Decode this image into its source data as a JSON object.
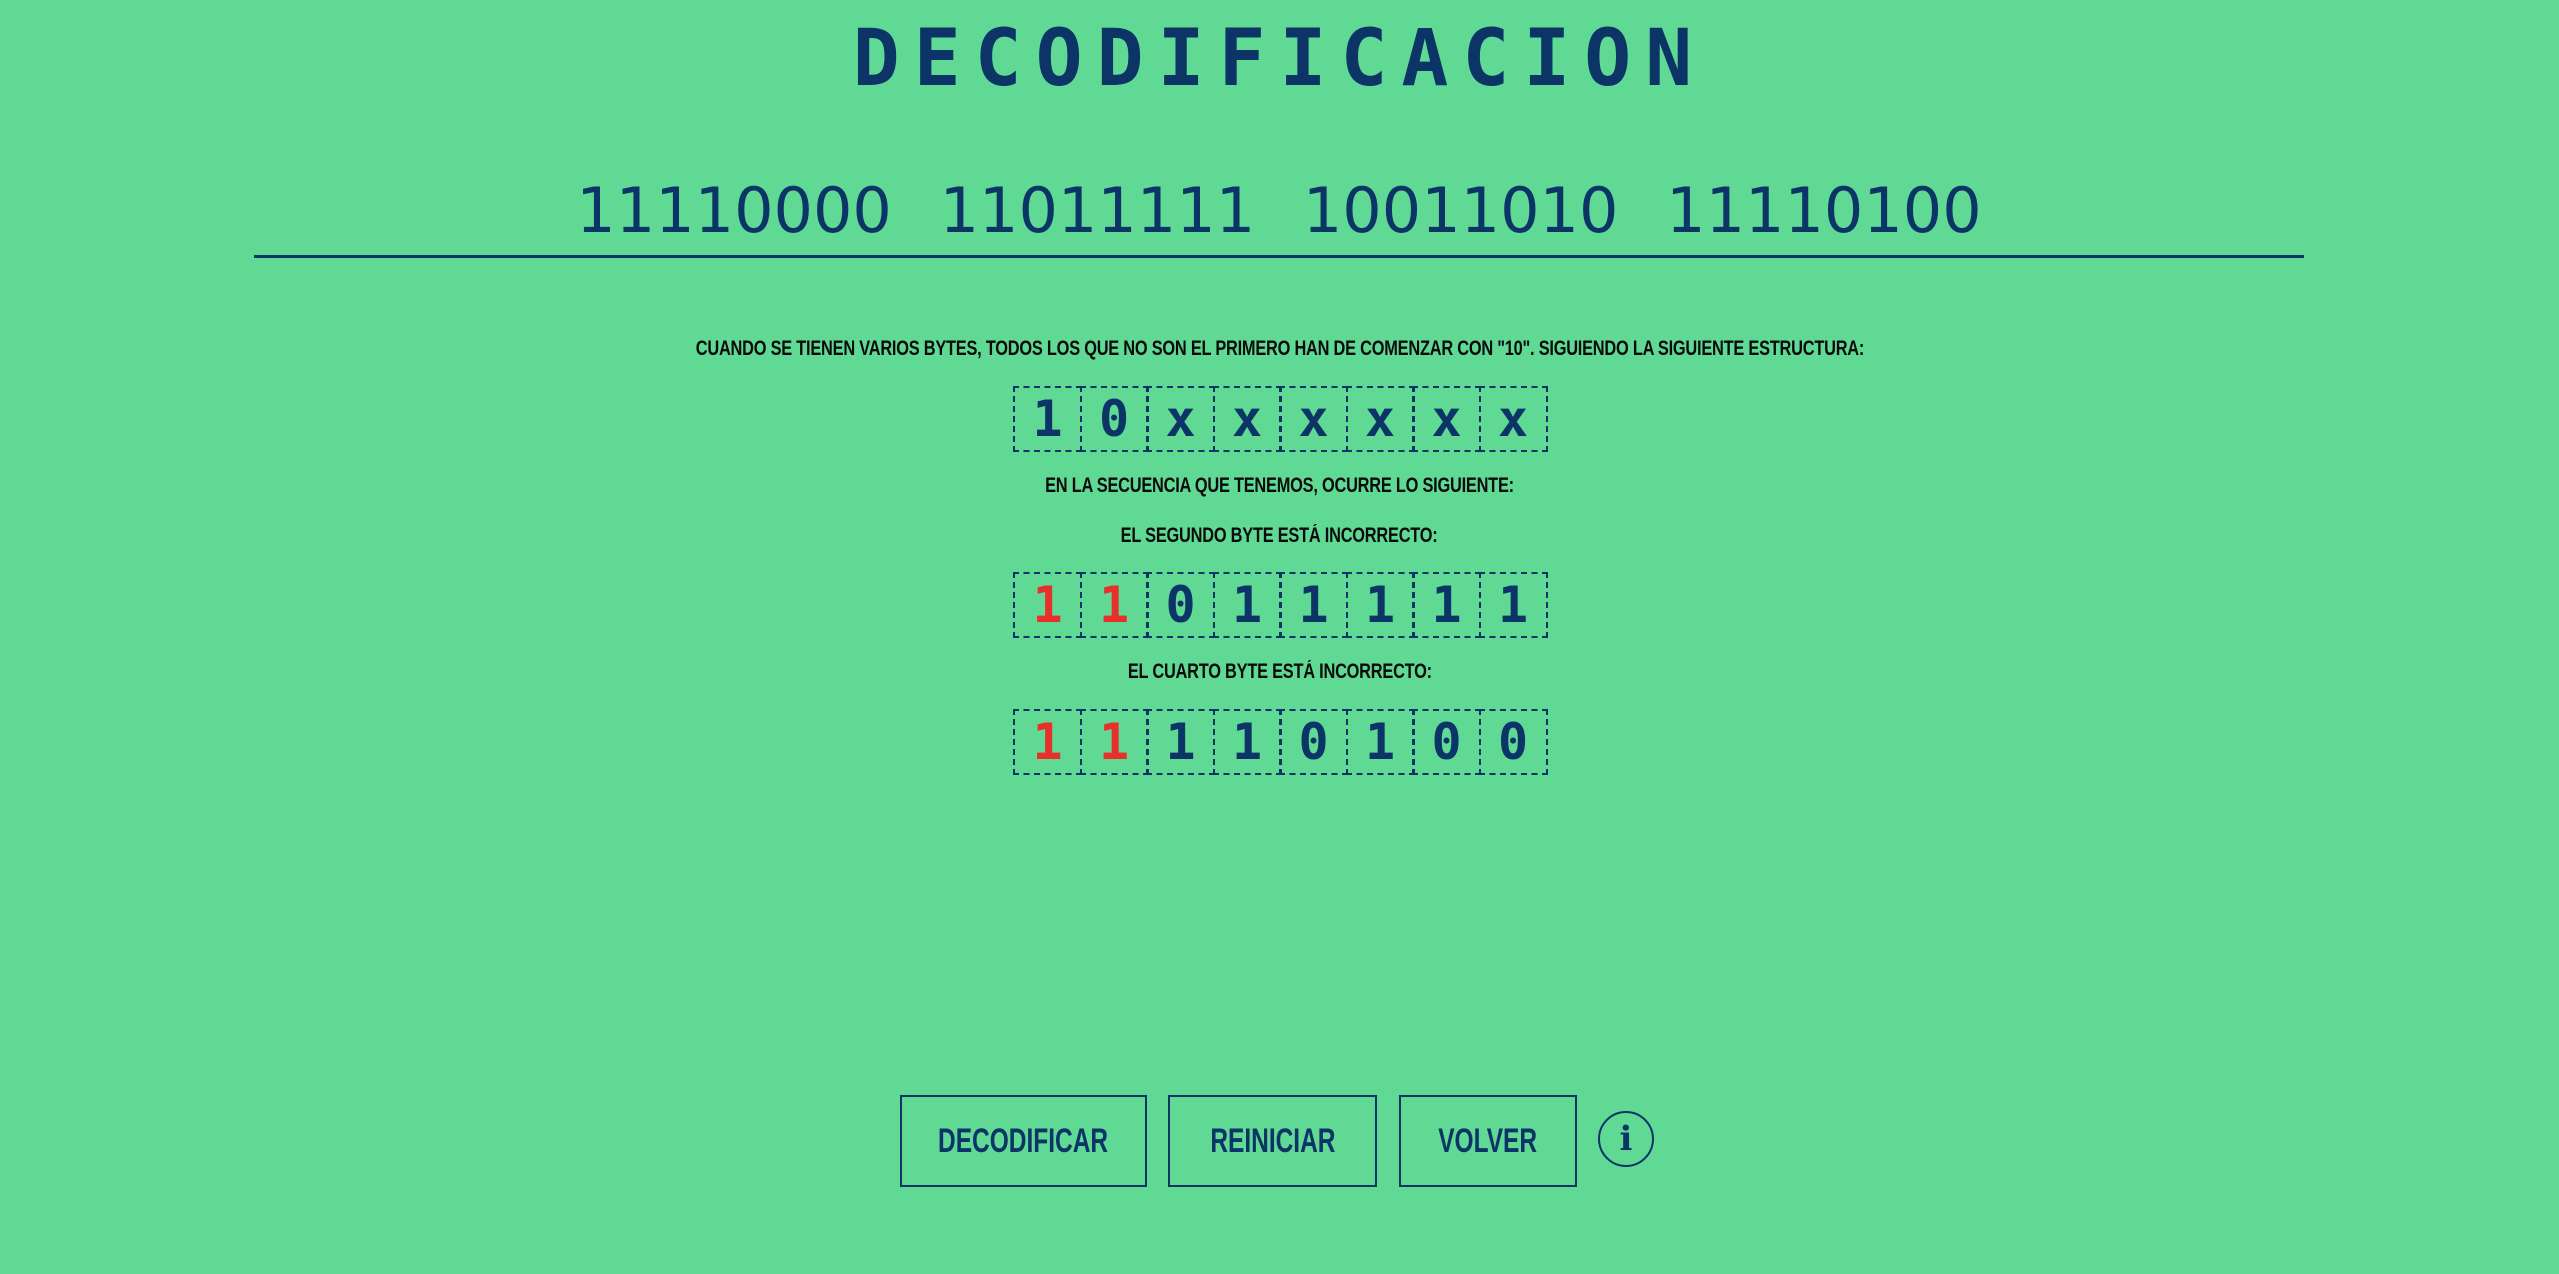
{
  "title": "DECODIFICACION",
  "input": {
    "value": "11110000 11011111 10011010 11110100"
  },
  "explanation": {
    "rule": "CUANDO SE TIENEN VARIOS BYTES, TODOS LOS QUE NO SON EL PRIMERO HAN DE COMENZAR CON \"10\". SIGUIENDO LA SIGUIENTE ESTRUCTURA:",
    "structure_bits": [
      "1",
      "0",
      "x",
      "x",
      "x",
      "x",
      "x",
      "x"
    ],
    "sequence_intro": "EN LA SECUENCIA QUE TENEMOS, OCURRE LO SIGUIENTE:",
    "errors": [
      {
        "label": "EL SEGUNDO BYTE ESTÁ INCORRECTO:",
        "bits": [
          "1",
          "1",
          "0",
          "1",
          "1",
          "1",
          "1",
          "1"
        ],
        "highlighted": [
          0,
          1
        ]
      },
      {
        "label": "EL CUARTO BYTE ESTÁ INCORRECTO:",
        "bits": [
          "1",
          "1",
          "1",
          "1",
          "0",
          "1",
          "0",
          "0"
        ],
        "highlighted": [
          0,
          1
        ]
      }
    ]
  },
  "buttons": {
    "decode": "DECODIFICAR",
    "reset": "REINICIAR",
    "back": "VOLVER",
    "info": "i"
  },
  "colors": {
    "background": "#5fd994",
    "primary": "#0c3467",
    "highlight": "#e8302a"
  },
  "icons": {
    "info": "info-icon"
  }
}
